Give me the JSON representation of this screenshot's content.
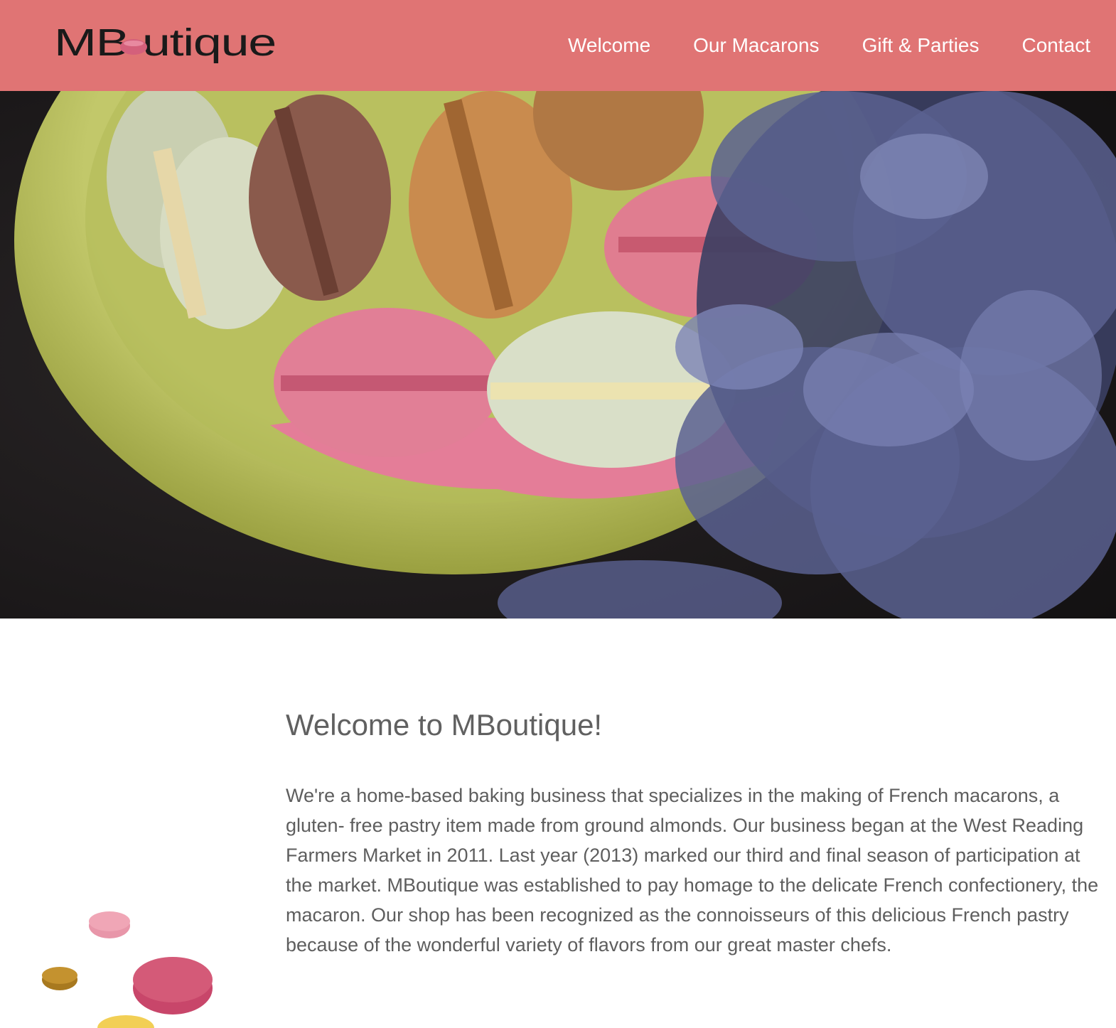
{
  "brand": {
    "logo_text": "MBoutique",
    "colors": {
      "header_bg": "#e07474",
      "logo_text": "#1a1a1a",
      "logo_macaron": "#d4607b",
      "nav_text": "#ffffff",
      "body_text": "#5e5e5e"
    }
  },
  "nav": {
    "items": [
      {
        "label": "Welcome"
      },
      {
        "label": "Our Macarons"
      },
      {
        "label": "Gift & Parties"
      },
      {
        "label": "Contact"
      }
    ]
  },
  "hero": {
    "image": "photo of pastel macarons in a green bowl with dried lavender on a dark table"
  },
  "main": {
    "title": "Welcome to MBoutique!",
    "body": "We're a home-based baking business that specializes in the making of French macarons, a gluten- free pastry item made from ground almonds. Our business began at the West Reading Farmers Market in 2011. Last year (2013) marked our third and final season of participation at the market. MBoutique was established to pay homage to the delicate French confectionery, the macaron. Our shop has been recognized as the connoisseurs of this delicious French pastry because of the wonderful variety of flavors from our great master chefs."
  },
  "decoration": {
    "icon": "macaron-cluster-icon",
    "colors": [
      "#f0a6b6",
      "#c4922f",
      "#d45a78",
      "#f2cf55"
    ]
  }
}
